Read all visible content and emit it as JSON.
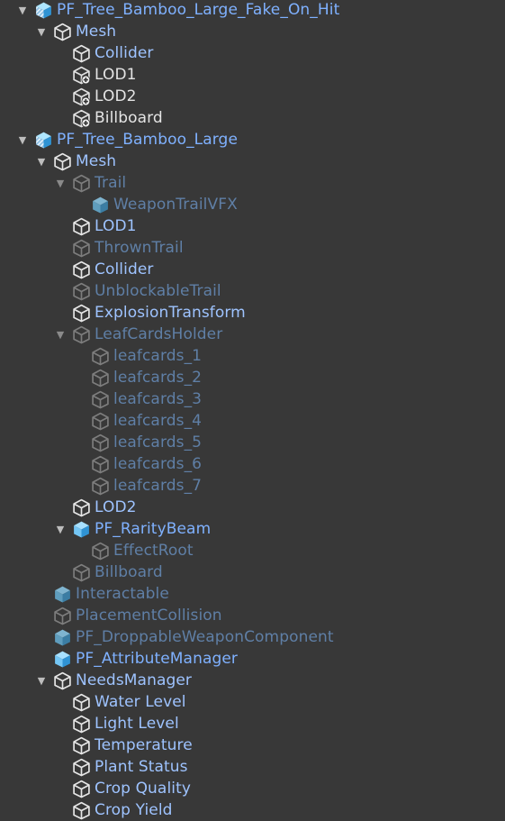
{
  "hierarchy": [
    {
      "label": "PF_Tree_Bamboo_Large_Fake_On_Hit",
      "depth": 0,
      "arrow": "expanded",
      "icon": "prefab-variant-icon",
      "style": "prefab"
    },
    {
      "label": "Mesh",
      "depth": 1,
      "arrow": "expanded",
      "icon": "gameobject-icon",
      "style": "blue"
    },
    {
      "label": "Collider",
      "depth": 2,
      "arrow": "none",
      "icon": "gameobject-icon",
      "style": "blue"
    },
    {
      "label": "LOD1",
      "depth": 2,
      "arrow": "none",
      "icon": "gameobject-added-icon",
      "style": "white"
    },
    {
      "label": "LOD2",
      "depth": 2,
      "arrow": "none",
      "icon": "gameobject-added-icon",
      "style": "white"
    },
    {
      "label": "Billboard",
      "depth": 2,
      "arrow": "none",
      "icon": "gameobject-added-icon",
      "style": "white"
    },
    {
      "label": "PF_Tree_Bamboo_Large",
      "depth": 0,
      "arrow": "expanded",
      "icon": "prefab-variant-icon",
      "style": "prefab"
    },
    {
      "label": "Mesh",
      "depth": 1,
      "arrow": "expanded",
      "icon": "gameobject-icon",
      "style": "blue"
    },
    {
      "label": "Trail",
      "depth": 2,
      "arrow": "expanded-dim",
      "icon": "gameobject-inactive-icon",
      "style": "dim"
    },
    {
      "label": "WeaponTrailVFX",
      "depth": 3,
      "arrow": "none",
      "icon": "prefab-inactive-icon",
      "style": "dim"
    },
    {
      "label": "LOD1",
      "depth": 2,
      "arrow": "none",
      "icon": "gameobject-icon",
      "style": "blue"
    },
    {
      "label": "ThrownTrail",
      "depth": 2,
      "arrow": "none",
      "icon": "gameobject-inactive-icon",
      "style": "dim"
    },
    {
      "label": "Collider",
      "depth": 2,
      "arrow": "none",
      "icon": "gameobject-icon",
      "style": "blue"
    },
    {
      "label": "UnblockableTrail",
      "depth": 2,
      "arrow": "none",
      "icon": "gameobject-inactive-icon",
      "style": "dim"
    },
    {
      "label": "ExplosionTransform",
      "depth": 2,
      "arrow": "none",
      "icon": "gameobject-icon",
      "style": "blue"
    },
    {
      "label": "LeafCardsHolder",
      "depth": 2,
      "arrow": "expanded-dim",
      "icon": "gameobject-inactive-icon",
      "style": "dim"
    },
    {
      "label": "leafcards_1",
      "depth": 3,
      "arrow": "none",
      "icon": "gameobject-inactive-icon",
      "style": "dim"
    },
    {
      "label": "leafcards_2",
      "depth": 3,
      "arrow": "none",
      "icon": "gameobject-inactive-icon",
      "style": "dim"
    },
    {
      "label": "leafcards_3",
      "depth": 3,
      "arrow": "none",
      "icon": "gameobject-inactive-icon",
      "style": "dim"
    },
    {
      "label": "leafcards_4",
      "depth": 3,
      "arrow": "none",
      "icon": "gameobject-inactive-icon",
      "style": "dim"
    },
    {
      "label": "leafcards_5",
      "depth": 3,
      "arrow": "none",
      "icon": "gameobject-inactive-icon",
      "style": "dim"
    },
    {
      "label": "leafcards_6",
      "depth": 3,
      "arrow": "none",
      "icon": "gameobject-inactive-icon",
      "style": "dim"
    },
    {
      "label": "leafcards_7",
      "depth": 3,
      "arrow": "none",
      "icon": "gameobject-inactive-icon",
      "style": "dim"
    },
    {
      "label": "LOD2",
      "depth": 2,
      "arrow": "none",
      "icon": "gameobject-icon",
      "style": "blue"
    },
    {
      "label": "PF_RarityBeam",
      "depth": 2,
      "arrow": "expanded",
      "icon": "prefab-icon",
      "style": "prefab"
    },
    {
      "label": "EffectRoot",
      "depth": 3,
      "arrow": "none",
      "icon": "gameobject-inactive-icon",
      "style": "dim"
    },
    {
      "label": "Billboard",
      "depth": 2,
      "arrow": "none",
      "icon": "gameobject-inactive-icon",
      "style": "dim"
    },
    {
      "label": "Interactable",
      "depth": 1,
      "arrow": "none",
      "icon": "prefab-inactive-icon",
      "style": "dim"
    },
    {
      "label": "PlacementCollision",
      "depth": 1,
      "arrow": "none",
      "icon": "gameobject-inactive-icon",
      "style": "dim"
    },
    {
      "label": "PF_DroppableWeaponComponent",
      "depth": 1,
      "arrow": "none",
      "icon": "prefab-inactive-icon",
      "style": "dim"
    },
    {
      "label": "PF_AttributeManager",
      "depth": 1,
      "arrow": "none",
      "icon": "prefab-icon",
      "style": "prefab"
    },
    {
      "label": "NeedsManager",
      "depth": 1,
      "arrow": "expanded",
      "icon": "gameobject-icon",
      "style": "blue"
    },
    {
      "label": "Water Level",
      "depth": 2,
      "arrow": "none",
      "icon": "gameobject-icon",
      "style": "blue"
    },
    {
      "label": "Light Level",
      "depth": 2,
      "arrow": "none",
      "icon": "gameobject-icon",
      "style": "blue"
    },
    {
      "label": "Temperature",
      "depth": 2,
      "arrow": "none",
      "icon": "gameobject-icon",
      "style": "blue"
    },
    {
      "label": "Plant Status",
      "depth": 2,
      "arrow": "none",
      "icon": "gameobject-icon",
      "style": "blue"
    },
    {
      "label": "Crop Quality",
      "depth": 2,
      "arrow": "none",
      "icon": "gameobject-icon",
      "style": "blue"
    },
    {
      "label": "Crop Yield",
      "depth": 2,
      "arrow": "none",
      "icon": "gameobject-icon",
      "style": "blue"
    }
  ]
}
